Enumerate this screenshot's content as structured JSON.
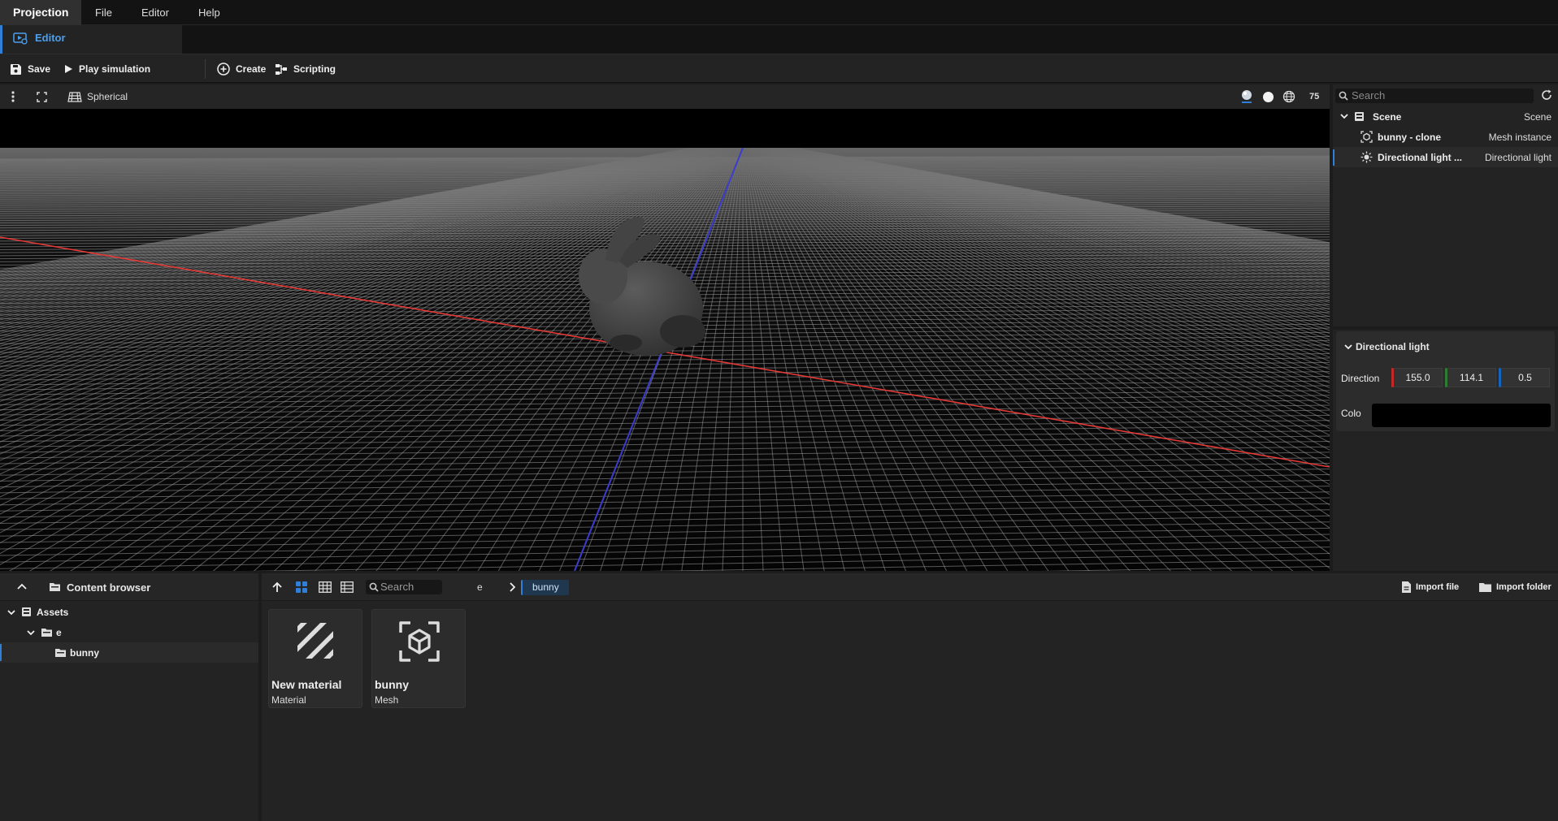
{
  "menu": {
    "brand": "Projection",
    "items": [
      "File",
      "Editor",
      "Help"
    ]
  },
  "tabs": [
    {
      "label": "Editor",
      "active": true
    }
  ],
  "toolbar": {
    "save": "Save",
    "play": "Play simulation",
    "create": "Create",
    "scripting": "Scripting"
  },
  "viewport": {
    "camera_mode": "Spherical",
    "fov": "75",
    "shading_modes": [
      "material-shading-icon",
      "flat-shading-icon",
      "wireframe-globe-icon"
    ]
  },
  "hierarchy": {
    "search_placeholder": "Search",
    "rows": [
      {
        "name": "Scene",
        "type": "Scene"
      },
      {
        "name": "bunny - clone",
        "type": "Mesh instance"
      },
      {
        "name": "Directional light ...",
        "type": "Directional light",
        "selected": true
      }
    ]
  },
  "properties": {
    "section": "Directional light",
    "direction_label": "Direction",
    "direction": {
      "x": "155.0",
      "y": "114.1",
      "z": "0.5"
    },
    "color_label": "Colo",
    "color_value": "#000000",
    "axis_colors": {
      "x": "#c62828",
      "y": "#2e7d32",
      "z": "#1565c0"
    }
  },
  "content_browser": {
    "title": "Content browser",
    "tree": [
      {
        "label": "Assets",
        "level": 0
      },
      {
        "label": "e",
        "level": 1
      },
      {
        "label": "bunny",
        "level": 2,
        "selected": true
      }
    ],
    "search_placeholder": "Search",
    "breadcrumb": [
      "e",
      "bunny"
    ],
    "import_file": "Import file",
    "import_folder": "Import folder",
    "assets": [
      {
        "name": "New material",
        "kind": "Material",
        "icon": "material-icon"
      },
      {
        "name": "bunny",
        "kind": "Mesh",
        "icon": "mesh-cube-icon"
      }
    ]
  },
  "colors": {
    "accent": "#2f7fd8",
    "x_axis": "#e53935",
    "z_axis": "#3c3cd0"
  }
}
